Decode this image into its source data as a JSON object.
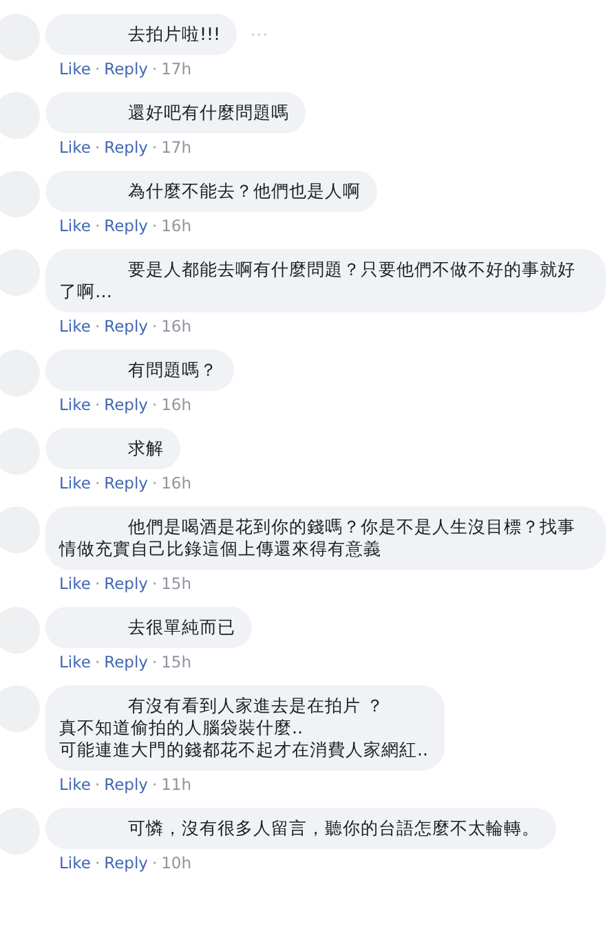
{
  "separator": "·",
  "comments": [
    {
      "lines": [
        "去拍片啦!!!"
      ],
      "more": "···",
      "like": "Like",
      "reply": "Reply",
      "time": "17h"
    },
    {
      "lines": [
        "還好吧有什麼問題嗎"
      ],
      "like": "Like",
      "reply": "Reply",
      "time": "17h"
    },
    {
      "lines": [
        "為什麼不能去？他們也是人啊"
      ],
      "like": "Like",
      "reply": "Reply",
      "time": "16h"
    },
    {
      "lines": [
        "要是人都能去啊有什麼問題？只要他們不做不好的事就好了啊…"
      ],
      "like": "Like",
      "reply": "Reply",
      "time": "16h"
    },
    {
      "lines": [
        "有問題嗎？"
      ],
      "like": "Like",
      "reply": "Reply",
      "time": "16h"
    },
    {
      "lines": [
        "求解"
      ],
      "like": "Like",
      "reply": "Reply",
      "time": "16h"
    },
    {
      "lines": [
        "他們是喝酒是花到你的錢嗎？你是不是人生沒目標？找事情做充實自己比錄這個上傳還來得有意義"
      ],
      "like": "Like",
      "reply": "Reply",
      "time": "15h"
    },
    {
      "lines": [
        "去很單純而已"
      ],
      "like": "Like",
      "reply": "Reply",
      "time": "15h"
    },
    {
      "lines": [
        "有沒有看到人家進去是在拍片 ？",
        "真不知道偷拍的人腦袋裝什麼..",
        "可能連進大門的錢都花不起才在消費人家網紅.."
      ],
      "like": "Like",
      "reply": "Reply",
      "time": "11h"
    },
    {
      "lines": [
        "可憐，沒有很多人留言，聽你的台語怎麼不太輪轉。"
      ],
      "like": "Like",
      "reply": "Reply",
      "time": "10h"
    }
  ]
}
